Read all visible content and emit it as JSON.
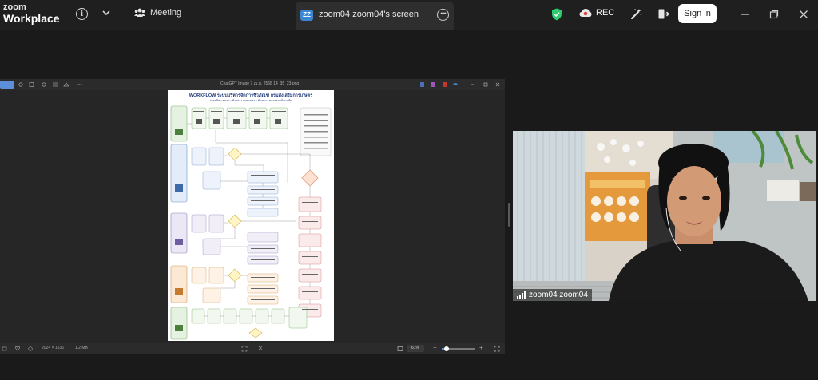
{
  "app": {
    "logo_line1": "zoom",
    "logo_line2": "Workplace",
    "icons": [
      "info-icon",
      "chevron-down-icon",
      "participants-icon",
      "shield-check-icon",
      "cloud-record-icon",
      "magic-wand-icon",
      "exit-icon",
      "minimize-icon",
      "maximize-icon",
      "close-icon"
    ]
  },
  "toolbar": {
    "meeting_label": "Meeting",
    "share_tab": {
      "avatar": "ZZ",
      "title": "zoom04 zoom04's screen"
    },
    "rec_label": "REC",
    "signin_label": "Sign in"
  },
  "colors": {
    "topbar_bg": "#1f1f1f",
    "stage_bg": "#1a1a1a",
    "share_avatar": "#3a86d1",
    "shield_green": "#2ecc71",
    "rec_red": "#e0433b"
  },
  "shared_screen": {
    "window_title": "ChatGPT Image 7 เม.ย. 2568 14_35_23.png",
    "document": {
      "title": "WORKFLOW ระบบบริหารจัดการชีวภัณฑ์ กรมส่งเสริมการเกษตร",
      "subtitle": "การผลิต • ขยาย • ตัวอย่าง • ขยายต่อ • ต้นทาง • ตรวจสอบย้อนกลับ"
    },
    "status_left": "2024 × 1536",
    "status_size": "1.2 MB",
    "zoom_level": "61%",
    "zoom_fraction": 0.15
  },
  "participant": {
    "name": "zoom04 zoom04"
  }
}
